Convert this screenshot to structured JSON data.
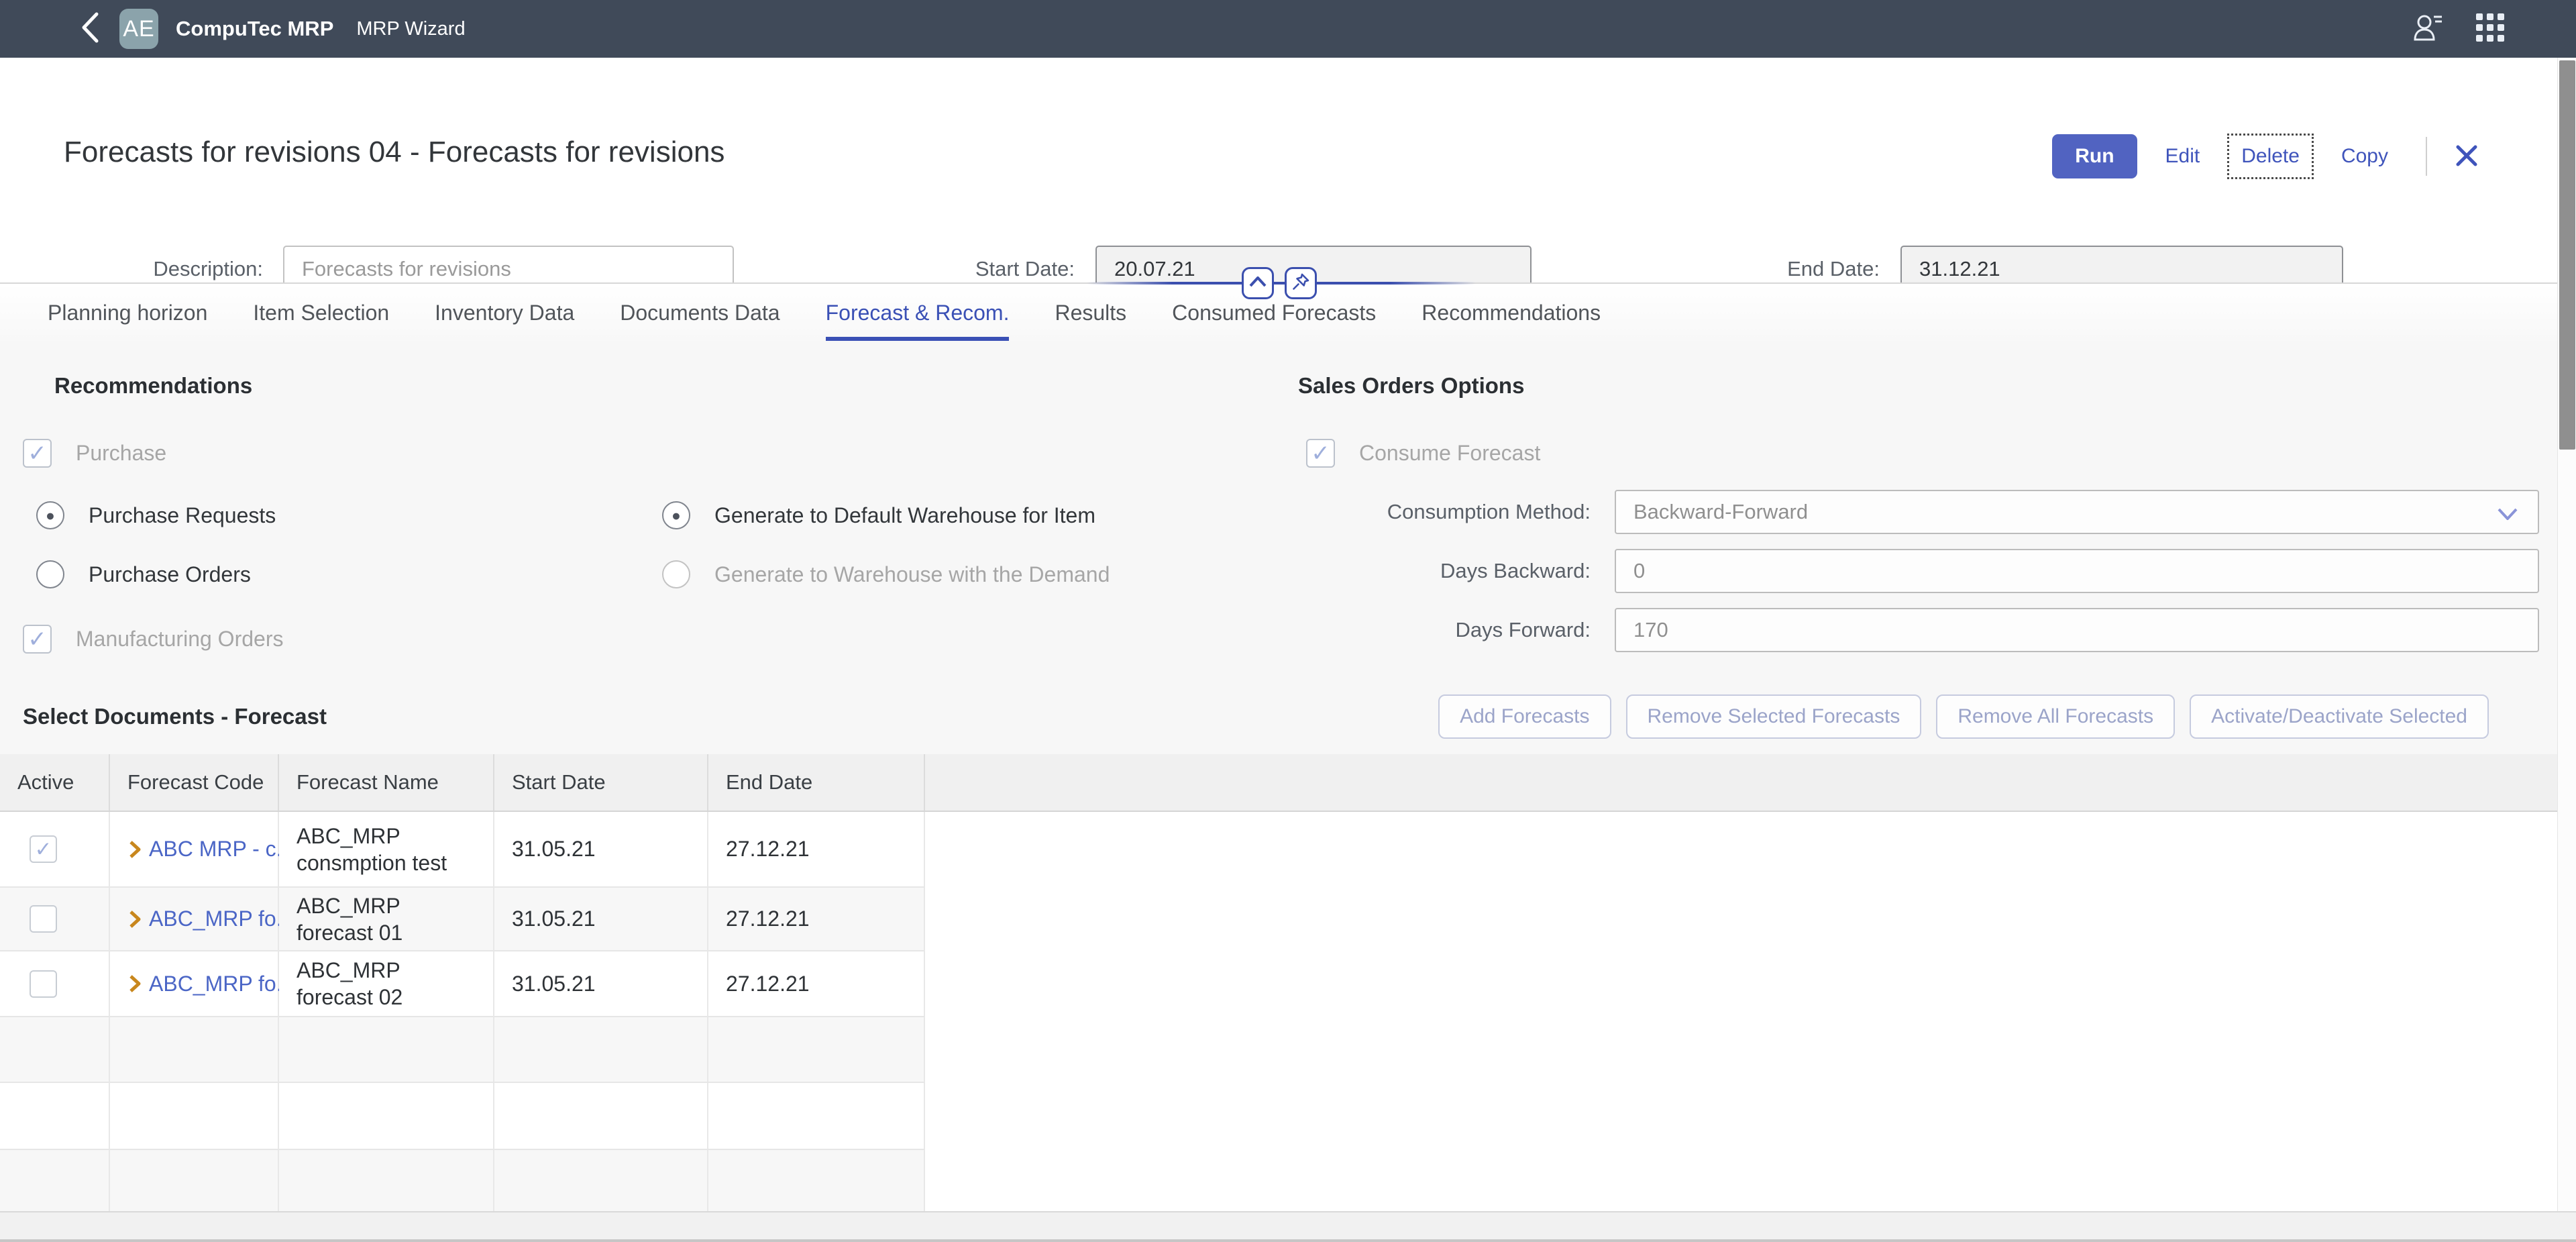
{
  "topbar": {
    "logo_text": "AE",
    "app_name": "CompuTec MRP",
    "page_name": "MRP Wizard"
  },
  "header": {
    "title": "Forecasts for revisions 04 - Forecasts for revisions",
    "actions": {
      "run": "Run",
      "edit": "Edit",
      "delete": "Delete",
      "copy": "Copy"
    },
    "fields": {
      "description": {
        "label": "Description:",
        "placeholder": "Forecasts for revisions",
        "value": ""
      },
      "start_date": {
        "label": "Start Date:",
        "value": "20.07.21"
      },
      "end_date": {
        "label": "End Date:",
        "value": "31.12.21"
      }
    }
  },
  "tabs": [
    {
      "label": "Planning horizon",
      "active": false
    },
    {
      "label": "Item Selection",
      "active": false
    },
    {
      "label": "Inventory Data",
      "active": false
    },
    {
      "label": "Documents Data",
      "active": false
    },
    {
      "label": "Forecast & Recom.",
      "active": true
    },
    {
      "label": "Results",
      "active": false
    },
    {
      "label": "Consumed Forecasts",
      "active": false
    },
    {
      "label": "Recommendations",
      "active": false
    }
  ],
  "recommendations": {
    "heading": "Recommendations",
    "purchase": {
      "label": "Purchase",
      "check": "✓",
      "disabled": true
    },
    "purchase_requests": {
      "label": "Purchase Requests",
      "dot": "●",
      "selected": true
    },
    "purchase_orders": {
      "label": "Purchase Orders",
      "dot": "",
      "selected": false
    },
    "manufacturing_orders": {
      "label": "Manufacturing Orders",
      "check": "✓",
      "disabled": true
    },
    "generate_default": {
      "label": "Generate to Default Warehouse for Item",
      "dot": "●",
      "selected": true
    },
    "generate_demand": {
      "label": "Generate to Warehouse with the Demand",
      "dot": "",
      "selected": false,
      "disabled": true
    }
  },
  "sales_orders_options": {
    "heading": "Sales Orders Options",
    "consume_forecast": {
      "label": "Consume Forecast",
      "check": "✓",
      "disabled": true
    },
    "consumption_method": {
      "label": "Consumption Method:",
      "value": "Backward-Forward"
    },
    "days_backward": {
      "label": "Days Backward:",
      "value": "0"
    },
    "days_forward": {
      "label": "Days Forward:",
      "value": "170"
    }
  },
  "select_documents": {
    "heading": "Select Documents - Forecast",
    "buttons": [
      "Add Forecasts",
      "Remove Selected Forecasts",
      "Remove All Forecasts",
      "Activate/Deactivate Selected"
    ]
  },
  "table": {
    "columns": [
      "Active",
      "Forecast Code",
      "Forecast Name",
      "Start Date",
      "End Date"
    ],
    "rows": [
      {
        "active_glyph": "✓",
        "code": "ABC MRP - c...",
        "name": "ABC_MRP consmption test",
        "start_date": "31.05.21",
        "end_date": "27.12.21"
      },
      {
        "active_glyph": "",
        "code": "ABC_MRP fo...",
        "name": "ABC_MRP forecast 01",
        "start_date": "31.05.21",
        "end_date": "27.12.21"
      },
      {
        "active_glyph": "",
        "code": "ABC_MRP fo...",
        "name": "ABC_MRP forecast 02",
        "start_date": "31.05.21",
        "end_date": "27.12.21"
      }
    ],
    "empty_row_count": 3
  },
  "colors": {
    "topbar_bg": "#404a59",
    "logo_bg": "#8ba3ab",
    "primary": "#5163c1",
    "action_blue": "#3f54bb",
    "link_blue": "#4b66c6",
    "tab_active": "#3a50b5",
    "amber_chevron": "#c8871d",
    "disabled_text": "#a6a6a6",
    "disabled_btn_text": "#9ba4c9",
    "disabled_btn_border": "#c6cbdf",
    "dark_text": "#32363a",
    "section_bg": "#f7f7f7",
    "table_header_bg": "#f0f0f0",
    "check_color": "#9fafdc"
  }
}
